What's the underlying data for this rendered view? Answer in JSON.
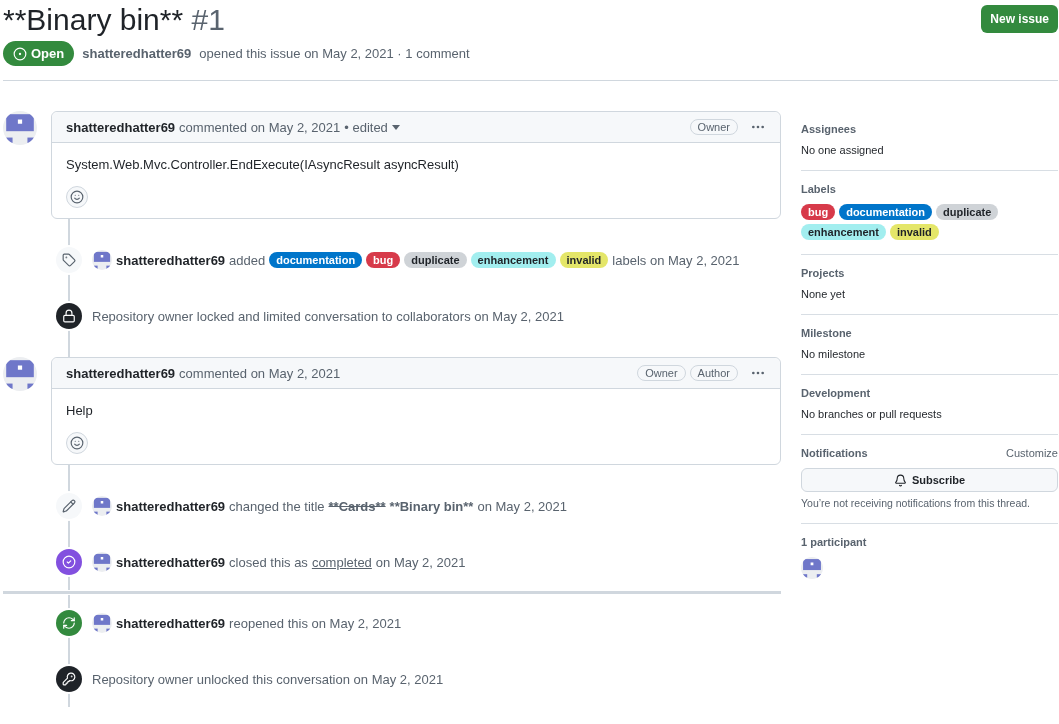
{
  "header": {
    "title": "**Binary bin**",
    "number": "#1",
    "new_issue_button": "New issue"
  },
  "state": {
    "kind": "open",
    "label": "Open",
    "author": "shatteredhatter69",
    "summary": "opened this issue on May 2, 2021 · 1 comment"
  },
  "timeline": [
    {
      "kind": "comment",
      "author": "shatteredhatter69",
      "meta": "commented on May 2, 2021",
      "edited": "• edited",
      "badges": [
        "Owner"
      ],
      "body": "System.Web.Mvc.Controller.EndExecute(IAsyncResult asyncResult)"
    },
    {
      "kind": "labeled",
      "parts": [
        {
          "kind": "actor",
          "text": "shatteredhatter69"
        },
        {
          "kind": "text",
          "text": "added"
        },
        {
          "kind": "label",
          "text": "documentation",
          "color": "#0075ca"
        },
        {
          "kind": "label",
          "text": "bug",
          "color": "#d73a4a"
        },
        {
          "kind": "label",
          "text": "duplicate",
          "color": "#cfd3d7"
        },
        {
          "kind": "label",
          "text": "enhancement",
          "color": "#a2eeef"
        },
        {
          "kind": "label",
          "text": "invalid",
          "color": "#e4e669"
        },
        {
          "kind": "text",
          "text": "labels on May 2, 2021"
        }
      ]
    },
    {
      "kind": "locked",
      "parts": [
        {
          "kind": "text",
          "text": "Repository owner locked and limited conversation to collaborators on May 2, 2021"
        }
      ]
    },
    {
      "kind": "comment",
      "author": "shatteredhatter69",
      "meta": "commented on May 2, 2021",
      "badges": [
        "Owner",
        "Author"
      ],
      "body": "Help"
    },
    {
      "kind": "renamed",
      "parts": [
        {
          "kind": "actor",
          "text": "shatteredhatter69"
        },
        {
          "kind": "text",
          "text": "changed the title"
        },
        {
          "kind": "old_title",
          "text": "**Cards**"
        },
        {
          "kind": "new_title",
          "text": "**Binary bin**"
        },
        {
          "kind": "text",
          "text": "on May 2, 2021"
        }
      ]
    },
    {
      "kind": "closed",
      "parts": [
        {
          "kind": "actor",
          "text": "shatteredhatter69"
        },
        {
          "kind": "text",
          "text": "closed this as"
        },
        {
          "kind": "link",
          "text": "completed"
        },
        {
          "kind": "text",
          "text": "on May 2, 2021"
        }
      ]
    },
    {
      "kind": "break"
    },
    {
      "kind": "reopened",
      "parts": [
        {
          "kind": "actor",
          "text": "shatteredhatter69"
        },
        {
          "kind": "text",
          "text": "reopened this on May 2, 2021"
        }
      ]
    },
    {
      "kind": "unlocked",
      "parts": [
        {
          "kind": "text",
          "text": "Repository owner unlocked this conversation on May 2, 2021"
        }
      ]
    }
  ],
  "sidebar": [
    {
      "kind": "text",
      "title": "Assignees",
      "value": "No one assigned"
    },
    {
      "kind": "labels",
      "title": "Labels",
      "labels": [
        {
          "text": "bug",
          "color": "#d73a4a"
        },
        {
          "text": "documentation",
          "color": "#0075ca"
        },
        {
          "text": "duplicate",
          "color": "#cfd3d7"
        },
        {
          "text": "enhancement",
          "color": "#a2eeef"
        },
        {
          "text": "invalid",
          "color": "#e4e669"
        }
      ]
    },
    {
      "kind": "text",
      "title": "Projects",
      "value": "None yet"
    },
    {
      "kind": "text",
      "title": "Milestone",
      "value": "No milestone"
    },
    {
      "kind": "text",
      "title": "Development",
      "value": "No branches or pull requests"
    },
    {
      "kind": "notifications",
      "title": "Notifications",
      "action": "Customize",
      "button": "Subscribe",
      "note": "You’re not receiving notifications from this thread."
    },
    {
      "kind": "participants",
      "title": "1 participant"
    }
  ]
}
